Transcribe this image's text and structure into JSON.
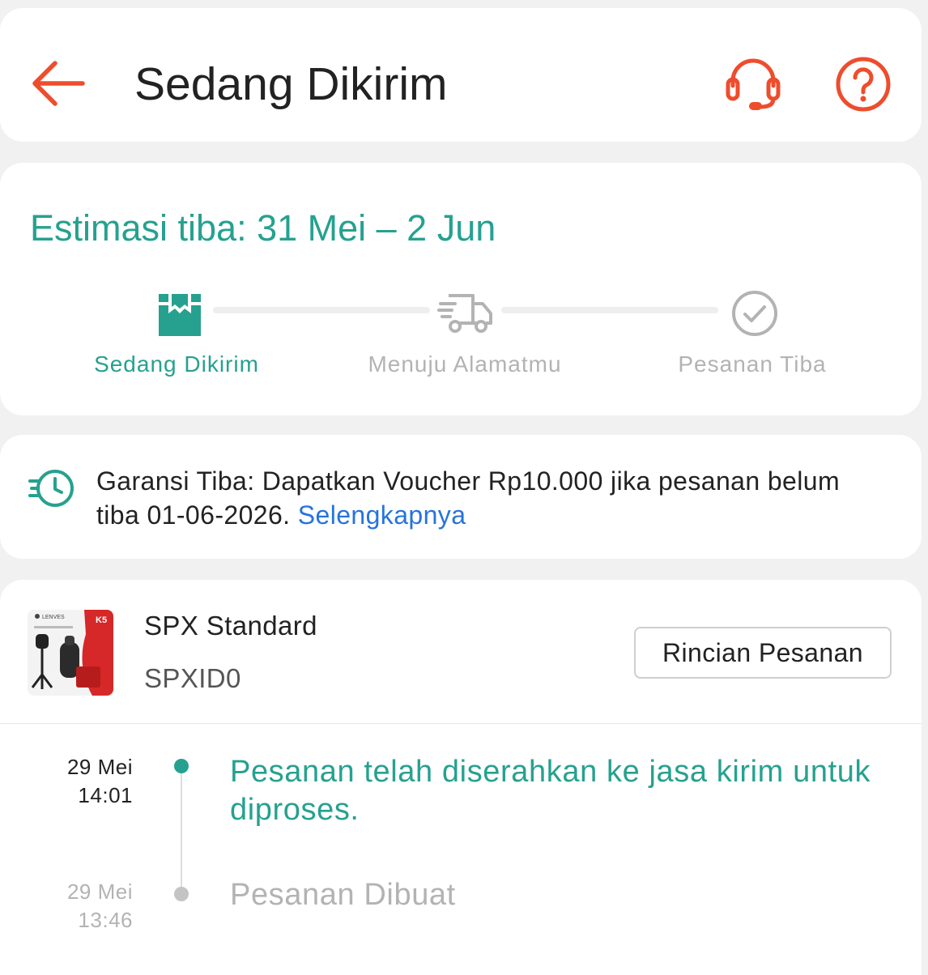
{
  "header": {
    "title": "Sedang Dikirim",
    "back_icon": "arrow-left-icon",
    "support_icon": "headset-icon",
    "help_icon": "question-circle-icon",
    "accent_color": "#ee4d2d"
  },
  "status": {
    "estimate": "Estimasi tiba: 31 Mei – 2 Jun",
    "steps": [
      {
        "label": "Sedang Dikirim",
        "icon": "package-icon",
        "active": true
      },
      {
        "label": "Menuju Alamatmu",
        "icon": "truck-icon",
        "active": false
      },
      {
        "label": "Pesanan Tiba",
        "icon": "check-circle-icon",
        "active": false
      }
    ],
    "active_color": "#26a18f",
    "inactive_color": "#b3b3b3"
  },
  "guarantee": {
    "icon": "fast-clock-icon",
    "text": "Garansi Tiba: Dapatkan Voucher Rp10.000 jika pesanan belum tiba 01-06-2026. ",
    "link_label": "Selengkapnya",
    "link_color": "#2673dd"
  },
  "shipment": {
    "courier": "SPX Standard",
    "tracking_number": "SPXID0",
    "detail_button_label": "Rincian Pesanan",
    "product_brand": "LENVES",
    "product_badge": "K5",
    "timeline": [
      {
        "date": "29 Mei",
        "time": "14:01",
        "text": "Pesanan telah diserahkan ke jasa kirim untuk diproses.",
        "active": true
      },
      {
        "date": "29 Mei",
        "time": "13:46",
        "text": "Pesanan Dibuat",
        "active": false
      }
    ]
  }
}
